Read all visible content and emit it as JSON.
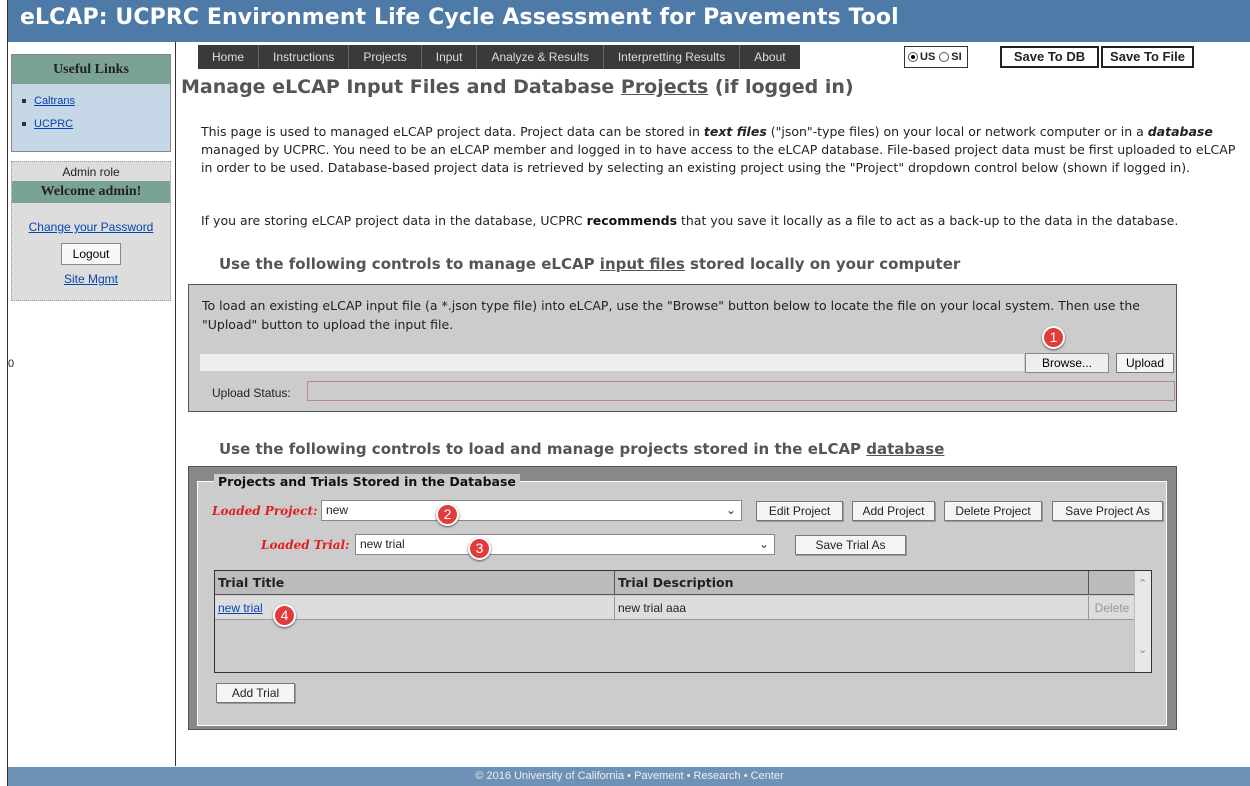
{
  "app": {
    "title": "eLCAP: UCPRC Environment Life Cycle Assessment for Pavements Tool"
  },
  "nav": {
    "items": [
      "Home",
      "Instructions",
      "Projects",
      "Input",
      "Analyze & Results",
      "Interpretting Results",
      "About"
    ]
  },
  "units": {
    "options": [
      "US",
      "SI"
    ],
    "selected": "US"
  },
  "toolbar": {
    "save_db": "Save To DB",
    "save_file": "Save To File"
  },
  "sidebar": {
    "useful_links_title": "Useful Links",
    "links": [
      "Caltrans",
      "UCPRC"
    ],
    "admin_role": "Admin role",
    "welcome": "Welcome admin!",
    "change_password": "Change your Password",
    "logout": "Logout",
    "site_mgmt": "Site Mgmt",
    "stray_text": "0"
  },
  "main": {
    "title_prefix": "Manage eLCAP Input Files and Database ",
    "title_link": "Projects",
    "title_suffix": " (if logged in)",
    "para1": {
      "a": "This page is used to managed eLCAP project data. Project data can be stored in ",
      "b": "text files",
      "c": " (\"json\"-type files) on your local or network computer or in a ",
      "d": "database",
      "e": " managed by UCPRC. You need to be an eLCAP member and logged in to have access to the eLCAP database. File-based project data must be first uploaded to eLCAP in order to be used. Database-based project data is retrieved by selecting an existing project using the \"Project\" dropdown control below (shown if logged in)."
    },
    "para2": {
      "a": "If you are storing eLCAP project data in the database, UCPRC ",
      "b": "recommends",
      "c": " that you save it locally as a file to act as a back-up to the data in the database."
    },
    "files_section": {
      "heading_prefix": "Use the following controls to manage eLCAP ",
      "heading_link": "input files",
      "heading_suffix": " stored locally on your computer",
      "instructions": "To load an existing eLCAP input file (a *.json type file) into eLCAP, use the \"Browse\" button below to locate the file on your local system. Then use the \"Upload\" button to upload the input file.",
      "file_path_value": "",
      "browse": "Browse...",
      "upload": "Upload",
      "upload_status_label": "Upload Status:",
      "upload_status_value": ""
    },
    "db_section": {
      "heading_prefix": "Use the following controls to load and manage projects stored in the eLCAP ",
      "heading_link": "database",
      "legend": "Projects and Trials Stored in the Database",
      "loaded_project_label": "Loaded Project:",
      "loaded_project_value": "new",
      "loaded_trial_label": "Loaded Trial:",
      "loaded_trial_value": "new trial",
      "buttons": {
        "edit_project": "Edit Project",
        "add_project": "Add Project",
        "delete_project": "Delete Project",
        "save_project_as": "Save Project As",
        "save_trial_as": "Save Trial As",
        "add_trial": "Add Trial"
      },
      "grid": {
        "columns": [
          "Trial Title",
          "Trial Description"
        ],
        "rows": [
          {
            "title": "new trial",
            "description": "new trial aaa",
            "action": "Delete"
          }
        ]
      }
    }
  },
  "markers": [
    "1",
    "2",
    "3",
    "4"
  ],
  "footer": "© 2016 University of California • Pavement • Research • Center"
}
